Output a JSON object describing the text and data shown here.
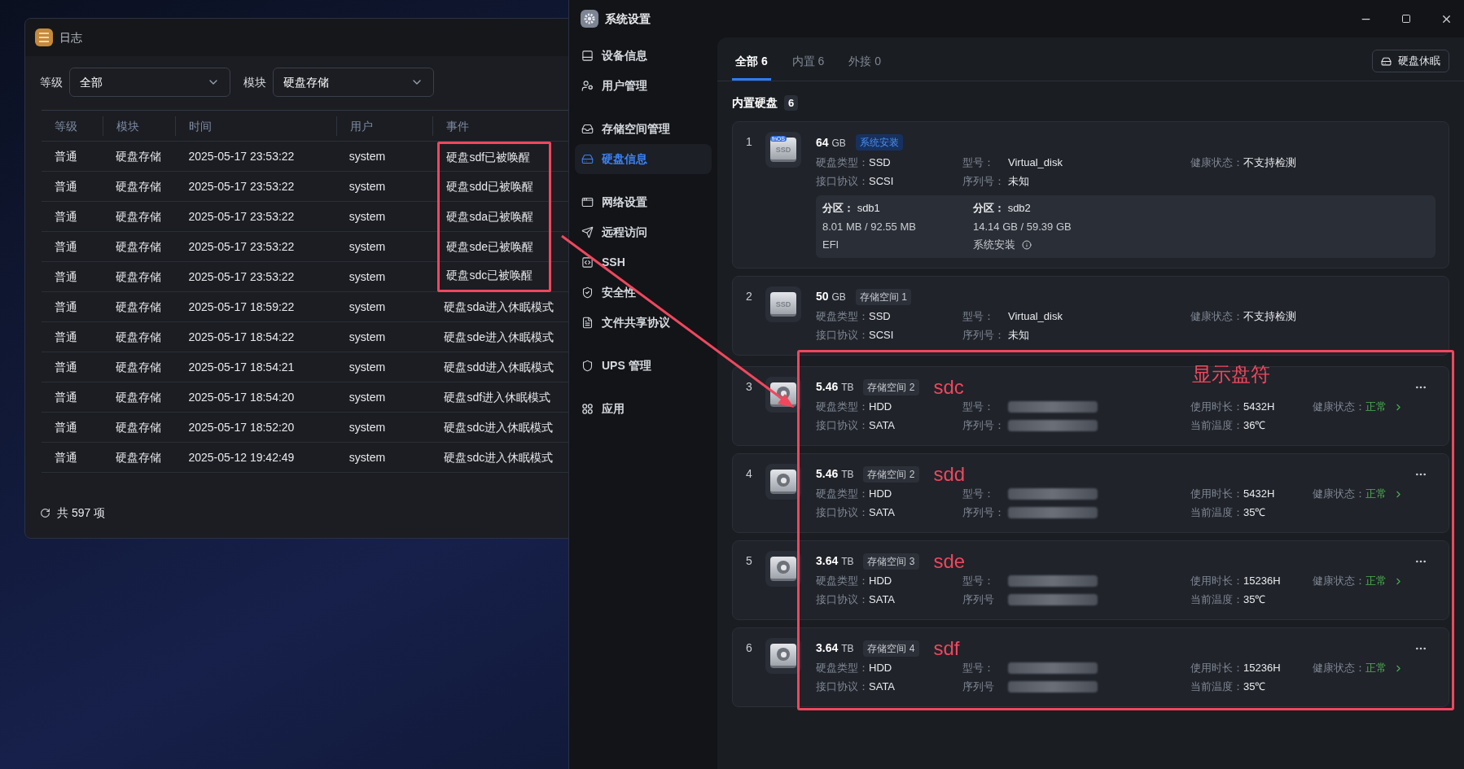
{
  "log_window": {
    "title": "日志",
    "filters": [
      {
        "label": "等级",
        "value": "全部"
      },
      {
        "label": "模块",
        "value": "硬盘存储"
      }
    ],
    "columns": [
      "等级",
      "模块",
      "时间",
      "用户",
      "事件"
    ],
    "rows": [
      {
        "cells": [
          "普通",
          "硬盘存储",
          "2025-05-17 23:53:22",
          "system",
          "硬盘sdf已被唤醒"
        ],
        "highlighted": true
      },
      {
        "cells": [
          "普通",
          "硬盘存储",
          "2025-05-17 23:53:22",
          "system",
          "硬盘sdd已被唤醒"
        ],
        "highlighted": true
      },
      {
        "cells": [
          "普通",
          "硬盘存储",
          "2025-05-17 23:53:22",
          "system",
          "硬盘sda已被唤醒"
        ],
        "highlighted": true
      },
      {
        "cells": [
          "普通",
          "硬盘存储",
          "2025-05-17 23:53:22",
          "system",
          "硬盘sde已被唤醒"
        ],
        "highlighted": true
      },
      {
        "cells": [
          "普通",
          "硬盘存储",
          "2025-05-17 23:53:22",
          "system",
          "硬盘sdc已被唤醒"
        ],
        "highlighted": true
      },
      {
        "cells": [
          "普通",
          "硬盘存储",
          "2025-05-17 18:59:22",
          "system",
          "硬盘sda进入休眠模式"
        ],
        "highlighted": false
      },
      {
        "cells": [
          "普通",
          "硬盘存储",
          "2025-05-17 18:54:22",
          "system",
          "硬盘sde进入休眠模式"
        ],
        "highlighted": false
      },
      {
        "cells": [
          "普通",
          "硬盘存储",
          "2025-05-17 18:54:21",
          "system",
          "硬盘sdd进入休眠模式"
        ],
        "highlighted": false
      },
      {
        "cells": [
          "普通",
          "硬盘存储",
          "2025-05-17 18:54:20",
          "system",
          "硬盘sdf进入休眠模式"
        ],
        "highlighted": false
      },
      {
        "cells": [
          "普通",
          "硬盘存储",
          "2025-05-17 18:52:20",
          "system",
          "硬盘sdc进入休眠模式"
        ],
        "highlighted": false
      },
      {
        "cells": [
          "普通",
          "硬盘存储",
          "2025-05-12 19:42:49",
          "system",
          "硬盘sdc进入休眠模式"
        ],
        "highlighted": false
      }
    ],
    "footer": "共 597 项"
  },
  "settings_window": {
    "title": "系统设置",
    "sidebar": {
      "groups": [
        {
          "items": [
            {
              "label": "设备信息",
              "kind": "device",
              "selected": false
            },
            {
              "label": "用户管理",
              "kind": "user",
              "selected": false
            }
          ]
        },
        {
          "items": [
            {
              "label": "存储空间管理",
              "kind": "storage",
              "selected": false
            },
            {
              "label": "硬盘信息",
              "kind": "disk",
              "selected": true
            }
          ]
        },
        {
          "items": [
            {
              "label": "网络设置",
              "kind": "network",
              "selected": false
            },
            {
              "label": "远程访问",
              "kind": "remote",
              "selected": false
            },
            {
              "label": "SSH",
              "kind": "ssh",
              "selected": false
            },
            {
              "label": "安全性",
              "kind": "security",
              "selected": false
            },
            {
              "label": "文件共享协议",
              "kind": "file",
              "selected": false
            }
          ]
        },
        {
          "items": [
            {
              "label": "UPS 管理",
              "kind": "ups",
              "selected": false
            }
          ]
        },
        {
          "items": [
            {
              "label": "应用",
              "kind": "apps",
              "selected": false
            }
          ]
        }
      ]
    },
    "tabs": [
      {
        "label": "全部 6",
        "selected": true
      },
      {
        "label": "内置 6",
        "selected": false
      },
      {
        "label": "外接 0",
        "selected": false
      }
    ],
    "sleep_button": "硬盘休眠",
    "section": {
      "title": "内置硬盘",
      "count": "6"
    },
    "annotation_note": "显示盘符",
    "disks": [
      {
        "index": "1",
        "kind": "ssd",
        "icon_label": "SSD",
        "icon_badge": "fnOS",
        "size": "64",
        "unit": "GB",
        "tag": {
          "label": "系统安装",
          "kind": "system"
        },
        "rows": [
          [
            {
              "label": "硬盘类型：",
              "value": "SSD"
            },
            {
              "label": "型号：",
              "value": "Virtual_disk"
            },
            {
              "label": "健康状态：",
              "value": "不支持检测"
            }
          ],
          [
            {
              "label": "接口协议：",
              "value": "SCSI"
            },
            {
              "label": "序列号：",
              "value": "未知"
            }
          ]
        ],
        "partitions": [
          {
            "label": "分区：",
            "name": "sdb1",
            "usage": "8.01 MB / 92.55 MB",
            "desc": "EFI",
            "info": false
          },
          {
            "label": "分区：",
            "name": "sdb2",
            "usage": "14.14 GB / 59.39 GB",
            "desc": "系统安装",
            "info": true
          }
        ]
      },
      {
        "index": "2",
        "kind": "ssd",
        "icon_label": "SSD",
        "size": "50",
        "unit": "GB",
        "tag": {
          "label": "存储空间 1",
          "kind": "storage"
        },
        "rows": [
          [
            {
              "label": "硬盘类型：",
              "value": "SSD"
            },
            {
              "label": "型号：",
              "value": "Virtual_disk"
            },
            {
              "label": "健康状态：",
              "value": "不支持检测"
            }
          ],
          [
            {
              "label": "接口协议：",
              "value": "SCSI"
            },
            {
              "label": "序列号：",
              "value": "未知"
            }
          ]
        ]
      },
      {
        "index": "3",
        "kind": "hdd",
        "size": "5.46",
        "unit": "TB",
        "tag": {
          "label": "存储空间 2",
          "kind": "storage"
        },
        "drive_letter": "sdc",
        "rows": [
          [
            {
              "label": "硬盘类型：",
              "value": "HDD"
            },
            {
              "label": "型号：",
              "redacted": true
            },
            {
              "label": "使用时长：",
              "value": "5432H"
            },
            {
              "label": "健康状态：",
              "value": "正常",
              "kind": "status"
            }
          ],
          [
            {
              "label": "接口协议：",
              "value": "SATA"
            },
            {
              "label": "序列号：",
              "redacted": true
            },
            {
              "label": "当前温度：",
              "value": "36℃"
            }
          ]
        ]
      },
      {
        "index": "4",
        "kind": "hdd",
        "size": "5.46",
        "unit": "TB",
        "tag": {
          "label": "存储空间 2",
          "kind": "storage"
        },
        "drive_letter": "sdd",
        "rows": [
          [
            {
              "label": "硬盘类型：",
              "value": "HDD"
            },
            {
              "label": "型号：",
              "redacted": true
            },
            {
              "label": "使用时长：",
              "value": "5432H"
            },
            {
              "label": "健康状态：",
              "value": "正常",
              "kind": "status"
            }
          ],
          [
            {
              "label": "接口协议：",
              "value": "SATA"
            },
            {
              "label": "序列号：",
              "redacted": true
            },
            {
              "label": "当前温度：",
              "value": "35℃"
            }
          ]
        ]
      },
      {
        "index": "5",
        "kind": "hdd",
        "size": "3.64",
        "unit": "TB",
        "tag": {
          "label": "存储空间 3",
          "kind": "storage"
        },
        "drive_letter": "sde",
        "rows": [
          [
            {
              "label": "硬盘类型：",
              "value": "HDD"
            },
            {
              "label": "型号：",
              "redacted": true
            },
            {
              "label": "使用时长：",
              "value": "15236H"
            },
            {
              "label": "健康状态：",
              "value": "正常",
              "kind": "status"
            }
          ],
          [
            {
              "label": "接口协议：",
              "value": "SATA"
            },
            {
              "label": "序列号",
              "redacted": true
            },
            {
              "label": "当前温度：",
              "value": "35℃"
            }
          ]
        ]
      },
      {
        "index": "6",
        "kind": "hdd",
        "size": "3.64",
        "unit": "TB",
        "tag": {
          "label": "存储空间 4",
          "kind": "storage"
        },
        "drive_letter": "sdf",
        "rows": [
          [
            {
              "label": "硬盘类型：",
              "value": "HDD"
            },
            {
              "label": "型号：",
              "redacted": true
            },
            {
              "label": "使用时长：",
              "value": "15236H"
            },
            {
              "label": "健康状态：",
              "value": "正常",
              "kind": "status"
            }
          ],
          [
            {
              "label": "接口协议：",
              "value": "SATA"
            },
            {
              "label": "序列号",
              "redacted": true
            },
            {
              "label": "当前温度：",
              "value": "35℃"
            }
          ]
        ]
      }
    ]
  }
}
